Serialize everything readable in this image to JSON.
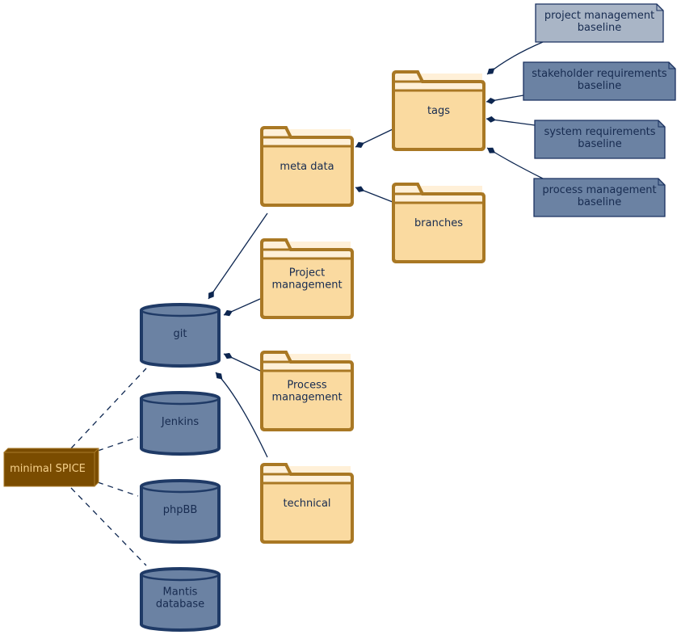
{
  "diagram": {
    "colors": {
      "folder_fill": "#fadaa0",
      "folder_tab": "#fff0d8",
      "folder_stroke": "#a97824",
      "db_fill": "#6b82a3",
      "db_stroke": "#1f3a66",
      "node_fill": "#7a4c00",
      "node_text": "#f5d08a",
      "note_fill": "#6b82a3",
      "note_light_fill": "#a9b5c6",
      "edge": "#0d2650"
    },
    "node": {
      "id": "spice",
      "label": [
        "minimal SPICE"
      ]
    },
    "databases": [
      {
        "id": "git",
        "label": [
          "git"
        ]
      },
      {
        "id": "jenkins",
        "label": [
          "Jenkins"
        ]
      },
      {
        "id": "phpbb",
        "label": [
          "phpBB"
        ]
      },
      {
        "id": "mantis",
        "label": [
          "Mantis",
          "database"
        ]
      }
    ],
    "folders": [
      {
        "id": "meta",
        "label": [
          "meta data"
        ]
      },
      {
        "id": "pm",
        "label": [
          "Project",
          "management"
        ]
      },
      {
        "id": "proc",
        "label": [
          "Process",
          "management"
        ]
      },
      {
        "id": "tech",
        "label": [
          "technical"
        ]
      },
      {
        "id": "tags",
        "label": [
          "tags"
        ]
      },
      {
        "id": "branches",
        "label": [
          "branches"
        ]
      }
    ],
    "notes": [
      {
        "id": "pmb",
        "label": [
          "project management",
          "baseline"
        ],
        "light": true
      },
      {
        "id": "srb",
        "label": [
          "stakeholder requirements",
          "baseline"
        ]
      },
      {
        "id": "sysb",
        "label": [
          "system requirements",
          "baseline"
        ]
      },
      {
        "id": "procb",
        "label": [
          "process management",
          "baseline"
        ]
      }
    ],
    "edges": [
      {
        "from": "spice",
        "to": "git",
        "style": "dashed"
      },
      {
        "from": "spice",
        "to": "jenkins",
        "style": "dashed"
      },
      {
        "from": "spice",
        "to": "phpbb",
        "style": "dashed"
      },
      {
        "from": "spice",
        "to": "mantis",
        "style": "dashed"
      },
      {
        "from": "git",
        "to": "meta",
        "style": "composition"
      },
      {
        "from": "git",
        "to": "pm",
        "style": "composition"
      },
      {
        "from": "git",
        "to": "proc",
        "style": "composition"
      },
      {
        "from": "git",
        "to": "tech",
        "style": "composition"
      },
      {
        "from": "meta",
        "to": "tags",
        "style": "composition"
      },
      {
        "from": "meta",
        "to": "branches",
        "style": "composition"
      },
      {
        "from": "tags",
        "to": "pmb",
        "style": "composition"
      },
      {
        "from": "tags",
        "to": "srb",
        "style": "composition"
      },
      {
        "from": "tags",
        "to": "sysb",
        "style": "composition"
      },
      {
        "from": "tags",
        "to": "procb",
        "style": "composition"
      }
    ]
  }
}
